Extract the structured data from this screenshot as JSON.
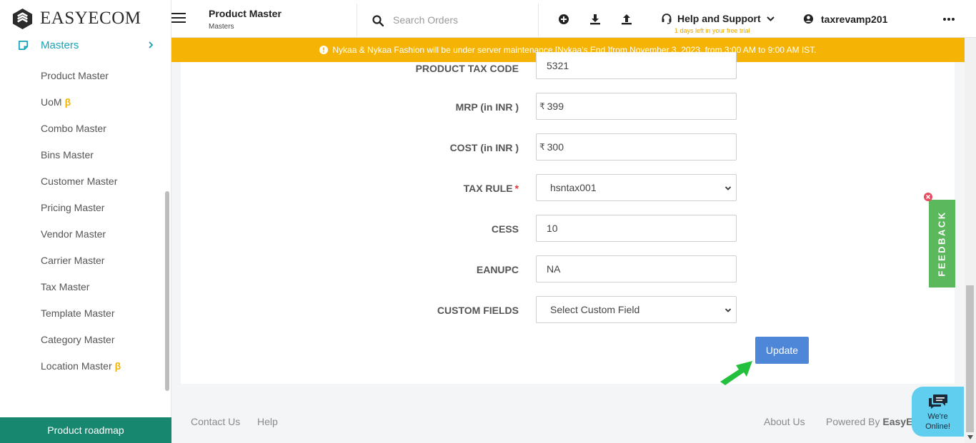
{
  "app": {
    "logo_text": "EASYECOM"
  },
  "sidebar": {
    "section_label": "Masters",
    "items": [
      {
        "label": "Product Master",
        "beta": ""
      },
      {
        "label": "UoM",
        "beta": "β"
      },
      {
        "label": "Combo Master",
        "beta": ""
      },
      {
        "label": "Bins Master",
        "beta": ""
      },
      {
        "label": "Customer Master",
        "beta": ""
      },
      {
        "label": "Pricing Master",
        "beta": ""
      },
      {
        "label": "Vendor Master",
        "beta": ""
      },
      {
        "label": "Carrier Master",
        "beta": ""
      },
      {
        "label": "Tax Master",
        "beta": ""
      },
      {
        "label": "Template Master",
        "beta": ""
      },
      {
        "label": "Category Master",
        "beta": ""
      },
      {
        "label": "Location Master",
        "beta": "β"
      }
    ],
    "roadmap_label": "Product roadmap"
  },
  "header": {
    "title": "Product Master",
    "subtitle": "Masters",
    "search_placeholder": "Search Orders",
    "help_label": "Help and Support",
    "trial_text": "1 days left in your free trial",
    "username": "taxrevamp201"
  },
  "banner": {
    "text": "Nykaa & Nykaa Fashion will be under server maintenance [Nykaa's End ]from November 3, 2023, from 3:00 AM to 9:00 AM IST."
  },
  "form": {
    "fields": [
      {
        "label": "PRODUCT TAX CODE",
        "value": "5321",
        "currency": "",
        "required": false,
        "select": false
      },
      {
        "label": "MRP (in INR )",
        "value": "399",
        "currency": "₹",
        "required": false,
        "select": false
      },
      {
        "label": "COST (in INR )",
        "value": "300",
        "currency": "₹",
        "required": false,
        "select": false
      },
      {
        "label": "TAX RULE",
        "value": "hsntax001",
        "currency": "",
        "required": true,
        "select": true
      },
      {
        "label": "CESS",
        "value": "10",
        "currency": "",
        "required": false,
        "select": false
      },
      {
        "label": "EANUPC",
        "value": "NA",
        "currency": "",
        "required": false,
        "select": false
      },
      {
        "label": "CUSTOM FIELDS",
        "value": "Select Custom Field",
        "currency": "",
        "required": false,
        "select": true
      }
    ],
    "required_mark": "*",
    "update_label": "Update"
  },
  "feedback": {
    "label": "FEEDBACK"
  },
  "footer": {
    "contact_label": "Contact Us",
    "help_label": "Help",
    "about_label": "About Us",
    "powered_prefix": "Powered By",
    "powered_brand": "EasyEcom"
  },
  "chat": {
    "line1": "We're",
    "line2": "Online!"
  },
  "colors": {
    "accent_teal": "#18a2b8",
    "banner_yellow": "#f5b405",
    "roadmap_green": "#17876f",
    "update_blue": "#4e86d8",
    "feedback_green": "#5cb85c",
    "chat_blue": "#60ceef",
    "arrow_green": "#22c03c"
  }
}
